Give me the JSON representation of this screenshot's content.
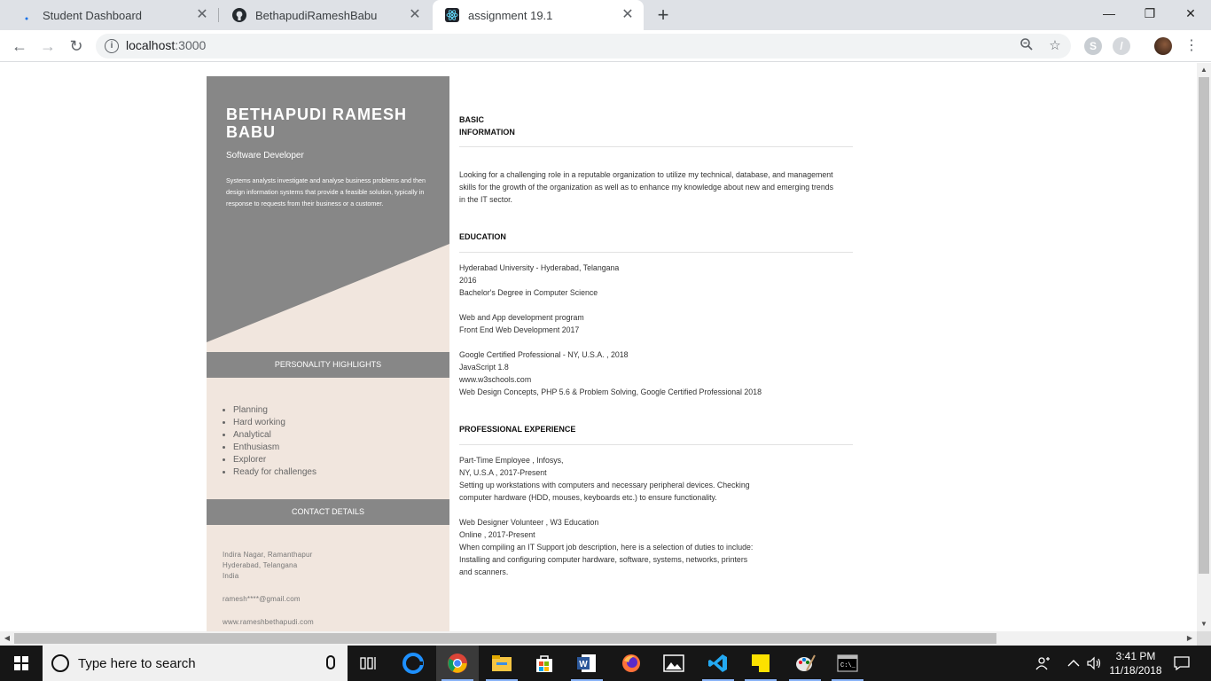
{
  "browser": {
    "tabs": [
      {
        "title": "Student Dashboard"
      },
      {
        "title": "BethapudiRameshBabu"
      },
      {
        "title": "assignment 19.1"
      }
    ],
    "new_tab": "+",
    "url": "localhost",
    "url_port": ":3000",
    "window_controls": {
      "minimize": "—",
      "restore": "❐",
      "close": "✕"
    }
  },
  "resume": {
    "name": "BETHAPUDI RAMESH BABU",
    "role": "Software Developer",
    "summary": "Systems analysts investigate and analyse business problems and then design information systems that provide a feasible solution, typically in response to requests from their business or a customer.",
    "highlights_title": "PERSONALITY HIGHLIGHTS",
    "highlights": [
      "Planning",
      "Hard working",
      "Analytical",
      "Enthusiasm",
      "Explorer",
      "Ready for challenges"
    ],
    "contact_title": "CONTACT DETAILS",
    "contact": {
      "address_line1": "Indira Nagar, Ramanthapur",
      "address_line2": "Hyderabad, Telangana",
      "address_line3": "India",
      "email": "ramesh****@gmail.com",
      "website": "www.rameshbethapudi.com"
    },
    "basic_title_1": "BASIC",
    "basic_title_2": "INFORMATION",
    "basic_text": "Looking for a challenging role in a reputable organization to utilize my technical, database, and management skills for the growth of the organization as well as to enhance my knowledge about new and emerging trends in the IT sector.",
    "education_title": "EDUCATION",
    "education": [
      {
        "line1": "Hyderabad University - Hyderabad, Telangana",
        "line2": "2016",
        "line3": "Bachelor's Degree in Computer Science"
      },
      {
        "line1": "Web and App development program",
        "line2": "Front End Web Development 2017"
      },
      {
        "line1": "Google Certified Professional - NY, U.S.A. , 2018",
        "line2": "JavaScript 1.8",
        "line3": "www.w3schools.com",
        "line4": "Web Design Concepts, PHP 5.6 & Problem Solving, Google Certified Professional 2018"
      }
    ],
    "experience_title": "PROFESSIONAL EXPERIENCE",
    "experience": [
      {
        "line1": "Part-Time Employee , Infosys,",
        "line2": "NY, U.S.A , 2017-Present",
        "desc": "Setting up workstations with computers and necessary peripheral devices. Checking computer hardware (HDD, mouses, keyboards etc.) to ensure functionality."
      },
      {
        "line1": "Web Designer Volunteer , W3 Education",
        "line2": "Online , 2017-Present",
        "desc": "When compiling an IT Support job description, here is a selection of duties to include: Installing and configuring computer hardware, software, systems, networks, printers and scanners."
      }
    ]
  },
  "taskbar": {
    "search_placeholder": "Type here to search",
    "time": "3:41 PM",
    "date": "11/18/2018"
  },
  "colors": {
    "sidebar_grey": "#878787",
    "sidebar_beige": "#f1e6de",
    "tab_strip": "#dee1e6"
  }
}
